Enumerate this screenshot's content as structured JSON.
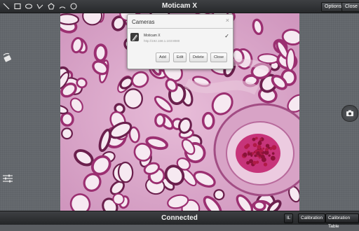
{
  "app": {
    "title": "Moticam X"
  },
  "toolbar": {
    "tools": [
      "line-tool-icon",
      "rectangle-tool-icon",
      "ellipse-tool-icon",
      "angle-tool-icon",
      "polygon-tool-icon",
      "arc-tool-icon",
      "circle-tool-icon"
    ],
    "options_label": "Options",
    "close_label": "Close"
  },
  "dialog": {
    "title": "Cameras",
    "close_glyph": "×",
    "camera": {
      "name": "Moticam X",
      "url": "http://192.168.1.103:8080",
      "selected": true,
      "check_glyph": "✓"
    },
    "buttons": {
      "add": "Add",
      "edit": "Edit",
      "delete": "Delete",
      "close": "Close"
    }
  },
  "status": {
    "text": "Connected"
  },
  "bottom": {
    "unit_label": "IL",
    "calibration_label": "Calibration",
    "calibration_table_label": "Calibration Table"
  },
  "colors": {
    "tissue_background": "#d9a6c8",
    "tissue_stroke": "#9b2f71",
    "tissue_dark": "#6b1f4d",
    "rbc": "#b01a46"
  }
}
